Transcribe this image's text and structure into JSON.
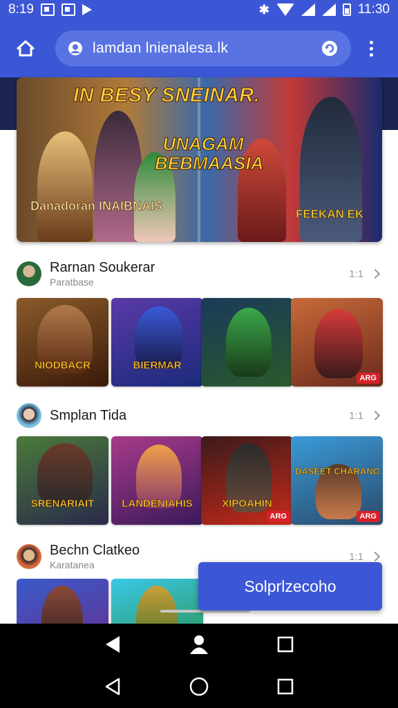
{
  "status_bar": {
    "left_time": "8:19",
    "right_time": "11:30",
    "bluetooth_glyph": "✱"
  },
  "toolbar": {
    "url": "lamdan lnienalesa.lk",
    "home_icon": "home-icon",
    "site_icon": "user-pin-icon",
    "reload_icon": "refresh-icon",
    "menu_icon": "more-vert-icon"
  },
  "banner": {
    "title": "IN BESY SNEINAR.",
    "center_title": "UNAGAM BEBMAASIA",
    "left_logo": "Danadoran INAIBNAIS",
    "right_logo": "FEEKAN EK"
  },
  "sections": [
    {
      "title": "Rarnan Soukerar",
      "subtitle": "Paratbase",
      "count": "1:1",
      "cards": [
        {
          "label": "NIODBACR",
          "badge": ""
        },
        {
          "label": "BIERMAR",
          "badge": ""
        },
        {
          "label": "",
          "badge": ""
        },
        {
          "label": "",
          "badge": "ARG"
        }
      ]
    },
    {
      "title": "Smplan Tida",
      "subtitle": "",
      "count": "1:1",
      "cards": [
        {
          "label": "SRENARIAIT",
          "badge": ""
        },
        {
          "label": "LANDENIAHIS",
          "badge": ""
        },
        {
          "label": "XIPOAHIN",
          "badge": "ARG"
        },
        {
          "label": "DASEET CHARANG",
          "badge": "ARG"
        }
      ]
    },
    {
      "title": "Bechn Clatkeo",
      "subtitle": "Karatanea",
      "count": "1:1",
      "cards": []
    }
  ],
  "action_button": {
    "label": "Solprlzecoho"
  },
  "colors": {
    "primary": "#3c57d6",
    "url_bar": "#5a73e2"
  }
}
